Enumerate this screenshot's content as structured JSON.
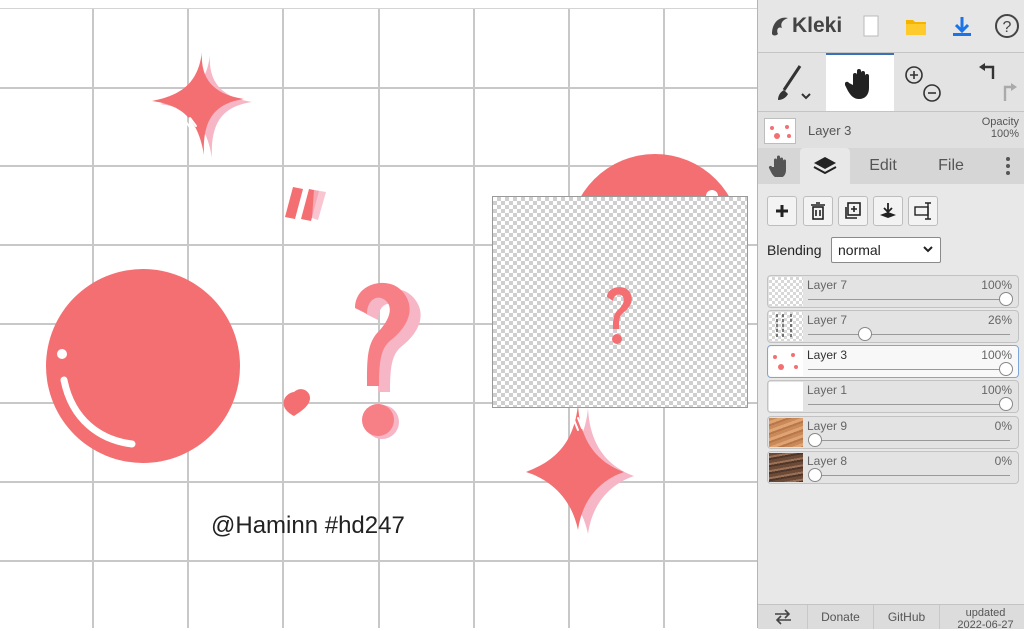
{
  "app": {
    "name": "Kleki",
    "accent_color": "#3c6fb5",
    "art_color": "#f36f72",
    "art_shadow_color": "#f6b6c6"
  },
  "canvas": {
    "watermark_text": "@Haminn #hd247",
    "preview_layer": "Layer 3"
  },
  "topbar": {
    "icons": [
      "kleki-logo-icon",
      "new-document-icon",
      "open-folder-icon",
      "download-icon",
      "help-icon"
    ]
  },
  "tools": {
    "items": [
      "brush-tool",
      "hand-tool",
      "zoom-in",
      "zoom-out",
      "undo",
      "redo"
    ],
    "active": "hand-tool"
  },
  "layer_info": {
    "current_layer": "Layer 3",
    "opacity_label": "Opacity",
    "opacity_value": "100%"
  },
  "tabs": {
    "edit": "Edit",
    "file": "File",
    "active": "layers"
  },
  "layer_actions": [
    "add-layer",
    "delete-layer",
    "duplicate-layer",
    "merge-down",
    "rename-layer"
  ],
  "blending": {
    "label": "Blending",
    "value": "normal"
  },
  "layers": [
    {
      "name": "Layer 7",
      "opacity": "100%",
      "level": 1.0,
      "thumb": "checker",
      "selected": false
    },
    {
      "name": "Layer 7",
      "opacity": "26%",
      "level": 0.26,
      "thumb": "lines",
      "selected": false
    },
    {
      "name": "Layer 3",
      "opacity": "100%",
      "level": 1.0,
      "thumb": "dots",
      "selected": true
    },
    {
      "name": "Layer 1",
      "opacity": "100%",
      "level": 1.0,
      "thumb": "white",
      "selected": false
    },
    {
      "name": "Layer 9",
      "opacity": "0%",
      "level": 0.0,
      "thumb": "wood-light",
      "selected": false
    },
    {
      "name": "Layer 8",
      "opacity": "0%",
      "level": 0.0,
      "thumb": "wood-dark",
      "selected": false
    }
  ],
  "footer": {
    "donate": "Donate",
    "github": "GitHub",
    "updated_label": "updated",
    "updated_date": "2022-06-27"
  }
}
